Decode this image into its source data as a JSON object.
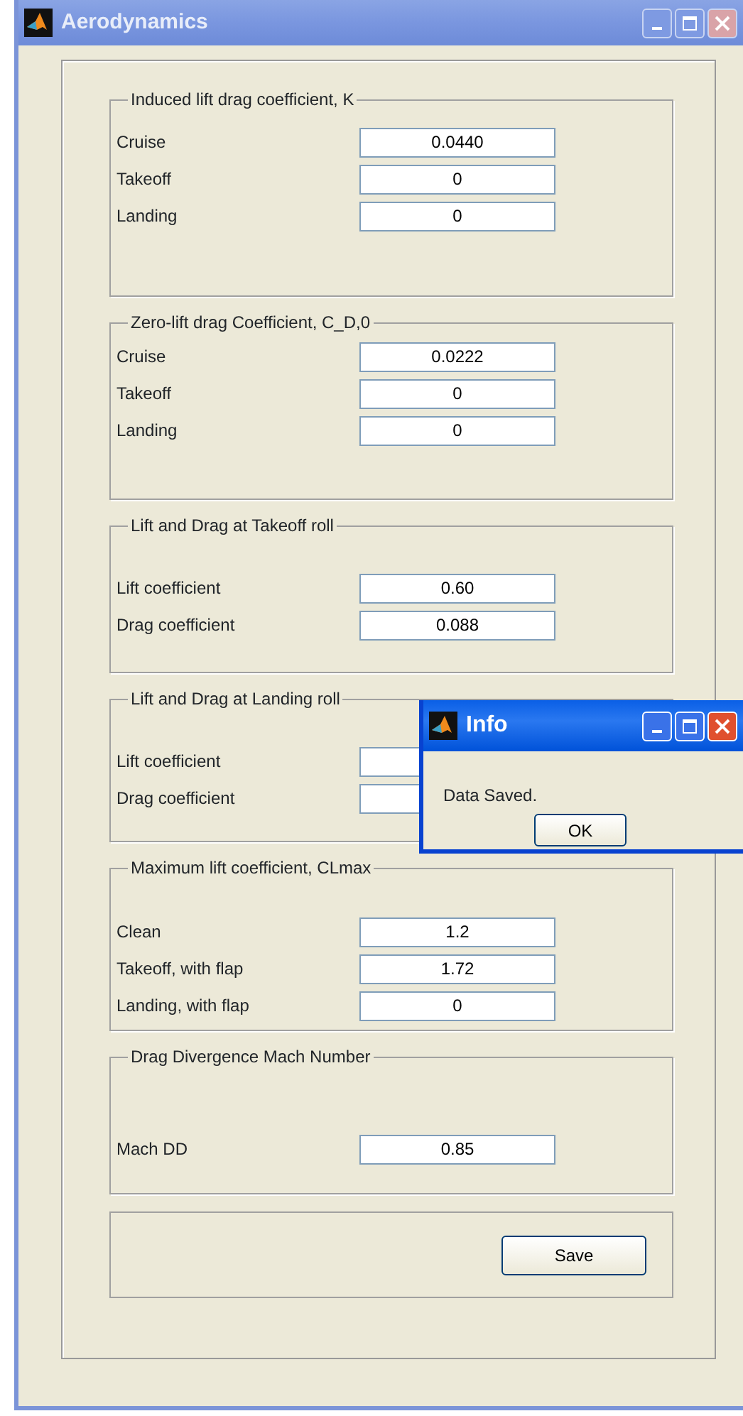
{
  "window": {
    "title": "Aerodynamics",
    "active": false
  },
  "groups": [
    {
      "title": "Induced lift drag coefficient, K",
      "fields": [
        {
          "label": "Cruise",
          "value": "0.0440"
        },
        {
          "label": "Takeoff",
          "value": "0"
        },
        {
          "label": "Landing",
          "value": "0"
        }
      ]
    },
    {
      "title": "Zero-lift drag Coefficient,  C_D,0",
      "fields": [
        {
          "label": "Cruise",
          "value": "0.0222"
        },
        {
          "label": "Takeoff",
          "value": "0"
        },
        {
          "label": "Landing",
          "value": "0"
        }
      ]
    },
    {
      "title": "Lift and Drag at Takeoff roll",
      "fields": [
        {
          "label": "Lift coefficient",
          "value": "0.60"
        },
        {
          "label": "Drag coefficient",
          "value": "0.088"
        }
      ]
    },
    {
      "title": "Lift and Drag at Landing roll",
      "fields": [
        {
          "label": "Lift coefficient"
        },
        {
          "label": "Drag coefficient"
        }
      ]
    },
    {
      "title": "Maximum lift coefficient, CLmax",
      "fields": [
        {
          "label": "Clean",
          "value": "1.2"
        },
        {
          "label": "Takeoff, with flap",
          "value": "1.72"
        },
        {
          "label": "Landing, with flap",
          "value": "0"
        }
      ]
    },
    {
      "title": "Drag Divergence Mach Number",
      "fields": [
        {
          "label": "Mach DD",
          "value": "0.85"
        }
      ]
    }
  ],
  "save_button": "Save",
  "dialog": {
    "title": "Info",
    "active": true,
    "message": "Data Saved.",
    "button": "OK"
  }
}
